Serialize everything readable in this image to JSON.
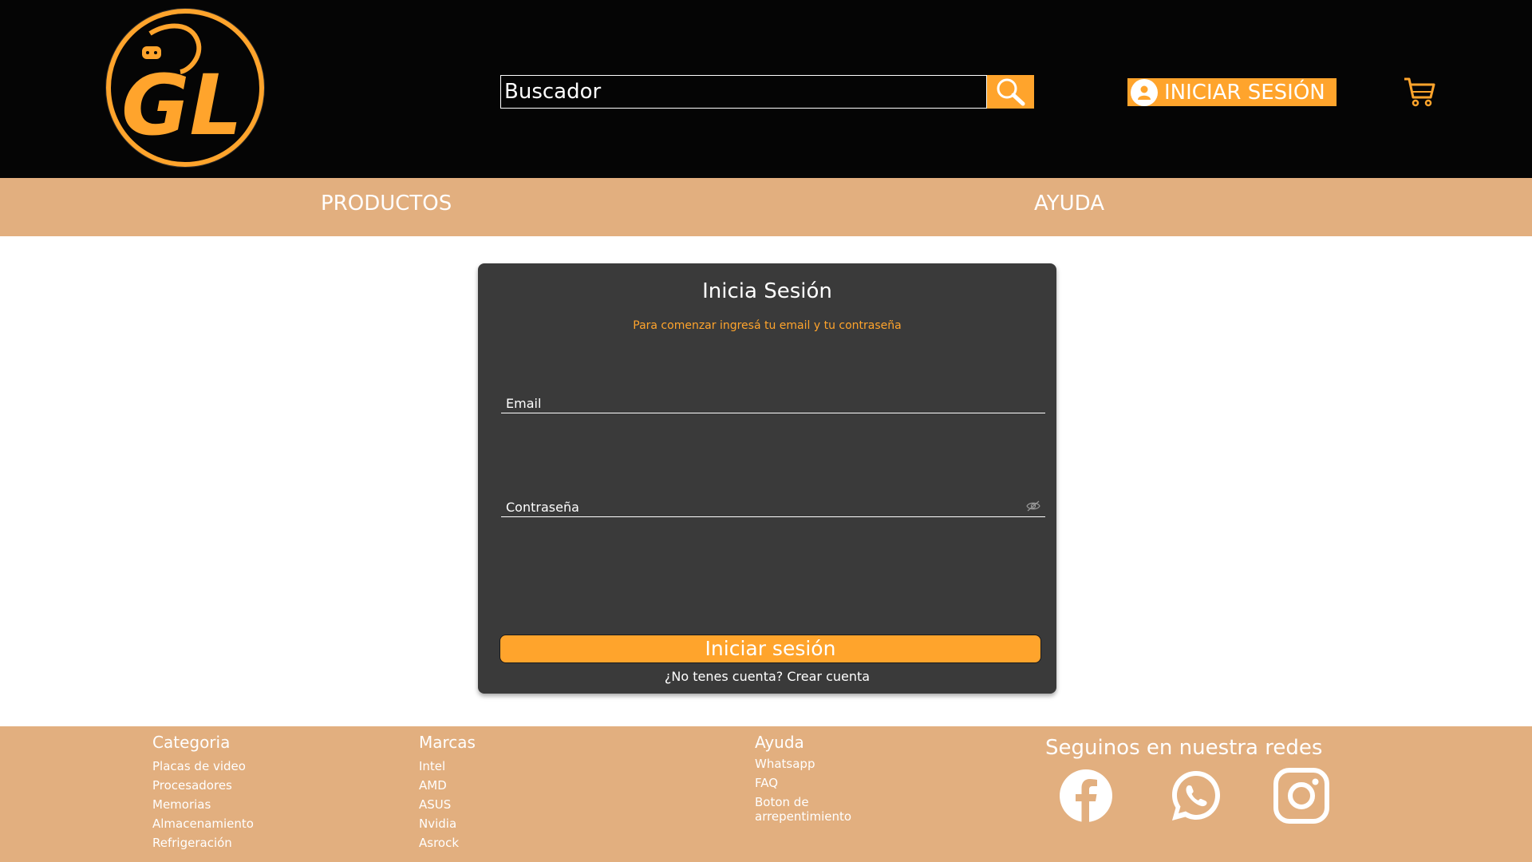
{
  "header": {
    "logo": {
      "text": "GL",
      "icon": "gamepad-logo-icon",
      "colors": {
        "ring": "#ffa42c",
        "fill": "#050505"
      }
    },
    "search": {
      "placeholder": "Buscador",
      "button_icon": "search-icon"
    },
    "login_button": {
      "label": "INICIAR SESIÓN",
      "icon": "user-icon"
    },
    "cart_icon": "cart-icon"
  },
  "nav": {
    "items": [
      {
        "label": "PRODUCTOS"
      },
      {
        "label": "AYUDA"
      }
    ]
  },
  "login_card": {
    "title": "Inicia Sesión",
    "subtitle": "Para comenzar ingresá tu email y tu contraseña",
    "email_label": "Email",
    "password_label": "Contraseña",
    "password_toggle_icon": "eye-slash-icon",
    "submit_label": "Iniciar sesión",
    "register_prompt": "¿No tenes cuenta?",
    "register_link": "Crear cuenta"
  },
  "footer": {
    "categoria": {
      "title": "Categoria",
      "items": [
        "Placas de video",
        "Procesadores",
        "Memorias",
        "Almacenamiento",
        "Refrigeración"
      ]
    },
    "marcas": {
      "title": "Marcas",
      "items": [
        "Intel",
        "AMD",
        "ASUS",
        "Nvidia",
        "Asrock"
      ]
    },
    "ayuda": {
      "title": "Ayuda",
      "items": [
        "Whatsapp",
        "FAQ",
        "Boton  de arrepentimiento"
      ]
    },
    "social": {
      "title": "Seguinos en nuestra redes",
      "icons": [
        "facebook-icon",
        "whatsapp-icon",
        "instagram-icon"
      ]
    }
  },
  "colors": {
    "accent": "#ffa42c",
    "header_bg": "#050505",
    "nav_bg": "#e2af7f",
    "card_bg": "#3a3a3a"
  }
}
